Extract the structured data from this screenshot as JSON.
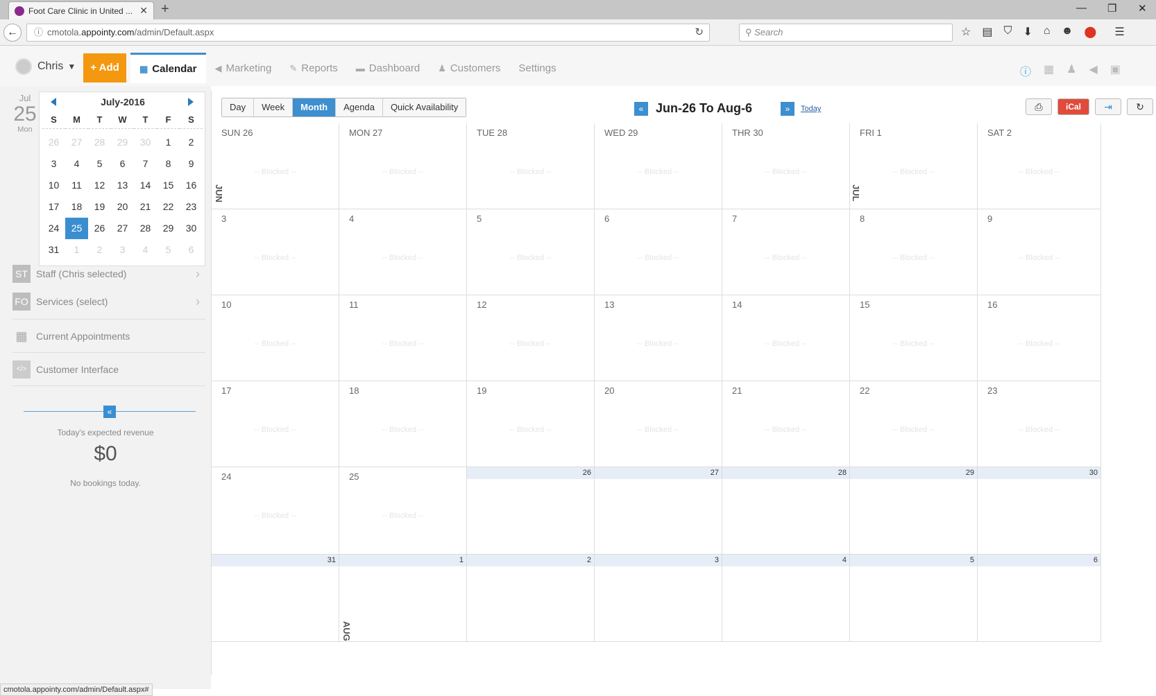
{
  "browser": {
    "tab_title": "Foot Care Clinic in United ...",
    "url_prefix": "cmotola.",
    "url_domain": "appointy.com",
    "url_path": "/admin/Default.aspx",
    "search_placeholder": "Search",
    "status_url": "cmotola.appointy.com/admin/Default.aspx#"
  },
  "header": {
    "user": "Chris",
    "add_label": "+ Add",
    "nav": [
      {
        "label": "Calendar",
        "icon": "calendar-icon",
        "active": true
      },
      {
        "label": "Marketing",
        "icon": "megaphone-icon"
      },
      {
        "label": "Reports",
        "icon": "reports-icon"
      },
      {
        "label": "Dashboard",
        "icon": "dashboard-icon"
      },
      {
        "label": "Customers",
        "icon": "customers-icon"
      },
      {
        "label": "Settings",
        "icon": ""
      }
    ]
  },
  "sidebar": {
    "date_month": "Jul",
    "date_day": "25",
    "date_weekday": "Mon",
    "mini_calendar": {
      "title": "July-2016",
      "dow": [
        "S",
        "M",
        "T",
        "W",
        "T",
        "F",
        "S"
      ],
      "weeks": [
        [
          "26",
          "27",
          "28",
          "29",
          "30",
          "1",
          "2"
        ],
        [
          "3",
          "4",
          "5",
          "6",
          "7",
          "8",
          "9"
        ],
        [
          "10",
          "11",
          "12",
          "13",
          "14",
          "15",
          "16"
        ],
        [
          "17",
          "18",
          "19",
          "20",
          "21",
          "22",
          "23"
        ],
        [
          "24",
          "25",
          "26",
          "27",
          "28",
          "29",
          "30"
        ],
        [
          "31",
          "1",
          "2",
          "3",
          "4",
          "5",
          "6"
        ]
      ],
      "selected": "25"
    },
    "staff_badge": "ST",
    "staff_label": "Staff (Chris selected)",
    "services_badge": "FO",
    "services_label": "Services (select)",
    "current_appointments": "Current Appointments",
    "customer_interface": "Customer Interface",
    "revenue_label": "Today's expected revenue",
    "revenue_value": "$0",
    "revenue_note": "No bookings today."
  },
  "calendar": {
    "views": [
      "Day",
      "Week",
      "Month",
      "Agenda",
      "Quick Availability"
    ],
    "active_view": "Month",
    "range_label": "Jun-26 To Aug-6",
    "today_label": "Today",
    "blocked_text": "-- Blocked --",
    "month_labels": [
      "JUN",
      "JUL",
      "AUG"
    ],
    "weeks": [
      [
        "SUN 26",
        "MON 27",
        "TUE 28",
        "WED 29",
        "THR 30",
        "FRI 1",
        "SAT 2"
      ],
      [
        "3",
        "4",
        "5",
        "6",
        "7",
        "8",
        "9"
      ],
      [
        "10",
        "11",
        "12",
        "13",
        "14",
        "15",
        "16"
      ],
      [
        "17",
        "18",
        "19",
        "20",
        "21",
        "22",
        "23"
      ],
      [
        "24",
        "25",
        "26",
        "27",
        "28",
        "29",
        "30"
      ],
      [
        "31",
        "1",
        "2",
        "3",
        "4",
        "5",
        "6"
      ]
    ]
  },
  "colors": {
    "accent": "#3d8fcf",
    "add_button": "#f3980f",
    "ical": "#e04b3c"
  }
}
